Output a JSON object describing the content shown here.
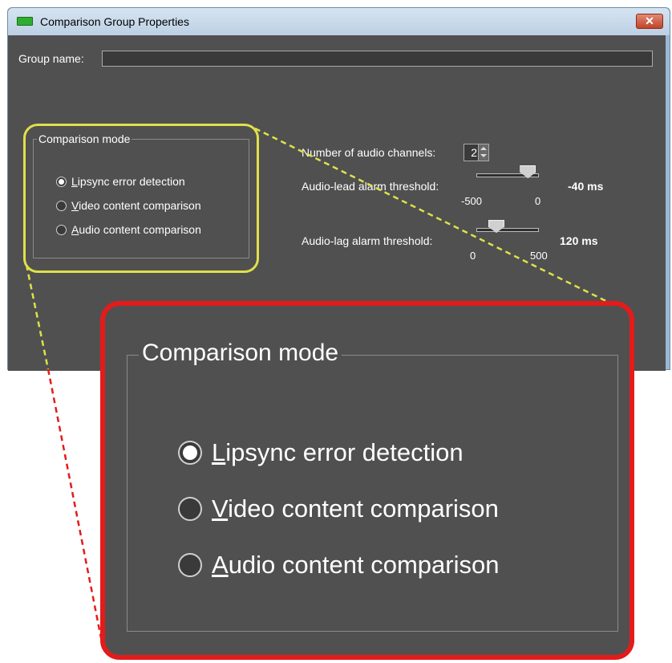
{
  "window": {
    "title": "Comparison Group Properties",
    "close_label": "✕"
  },
  "form": {
    "group_name_label": "Group name:",
    "group_name_value": "",
    "comparison_mode": {
      "legend": "Comparison mode",
      "selected": 0,
      "options": [
        {
          "mnemonic": "L",
          "rest": "ipsync error detection"
        },
        {
          "mnemonic": "V",
          "rest": "ideo content comparison"
        },
        {
          "mnemonic": "A",
          "rest": "udio content comparison"
        }
      ]
    },
    "audio_channels": {
      "label": "Number of audio channels:",
      "value": "2"
    },
    "audio_lead": {
      "label": "Audio-lead alarm threshold:",
      "value_text": "-40 ms",
      "min_label": "-500",
      "max_label": "0",
      "min": -500,
      "max": 0,
      "value": -40
    },
    "audio_lag": {
      "label": "Audio-lag alarm threshold:",
      "value_text": "120 ms",
      "min_label": "0",
      "max_label": "500",
      "min": 0,
      "max": 500,
      "value": 120
    }
  },
  "colors": {
    "panel_bg": "#505050",
    "highlight_outline": "#e0e04a",
    "zoom_frame": "#e41b1b"
  }
}
